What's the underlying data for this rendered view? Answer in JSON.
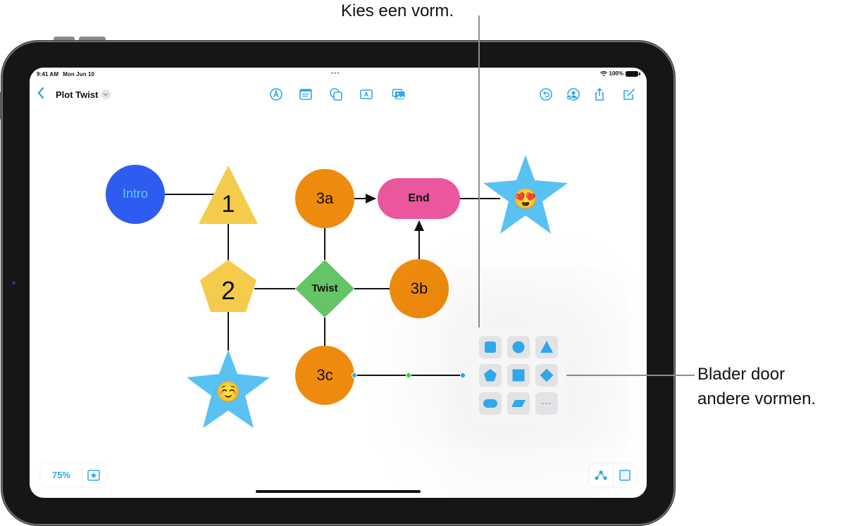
{
  "callouts": {
    "top": "Kies een vorm.",
    "right_line1": "Blader door",
    "right_line2": "andere vormen."
  },
  "status_bar": {
    "time": "9:41 AM",
    "date": "Mon Jun 10",
    "multitask": "•••",
    "battery": "100%",
    "wifi_icon": "wifi-icon",
    "battery_icon": "battery-icon"
  },
  "toolbar": {
    "back_icon": "chevron-left-icon",
    "title": "Plot Twist",
    "title_menu_icon": "chevron-down-icon",
    "center_tools": [
      "pen-icon",
      "text-box-icon",
      "shapes-icon",
      "text-icon",
      "media-icon"
    ],
    "right_tools": [
      "undo-icon",
      "collaborate-icon",
      "share-icon",
      "new-board-icon"
    ]
  },
  "board": {
    "nodes": [
      {
        "id": "intro",
        "label": "Intro",
        "shape": "circle",
        "color": "#2f5cf0",
        "text_color": "#5ac8fa"
      },
      {
        "id": "n1",
        "label": "1",
        "shape": "triangle",
        "color": "#f5cb4b",
        "text_color": "#111111"
      },
      {
        "id": "n2",
        "label": "2",
        "shape": "pentagon",
        "color": "#f5cb4b",
        "text_color": "#111111"
      },
      {
        "id": "star1",
        "label": "☺️",
        "shape": "star",
        "color": "#5ac1f3",
        "text_color": "#111111"
      },
      {
        "id": "n3a",
        "label": "3a",
        "shape": "circle",
        "color": "#ee8a0d",
        "text_color": "#111111"
      },
      {
        "id": "twist",
        "label": "Twist",
        "shape": "diamond",
        "color": "#64c466",
        "text_color": "#111111"
      },
      {
        "id": "n3c",
        "label": "3c",
        "shape": "circle",
        "color": "#ee8a0d",
        "text_color": "#111111"
      },
      {
        "id": "end",
        "label": "End",
        "shape": "rounded-rect",
        "color": "#ea579d",
        "text_color": "#111111"
      },
      {
        "id": "n3b",
        "label": "3b",
        "shape": "circle",
        "color": "#ee8a0d",
        "text_color": "#111111"
      },
      {
        "id": "star2",
        "label": "😍",
        "shape": "star",
        "color": "#5ac1f3",
        "text_color": "#111111"
      }
    ],
    "connections": [
      {
        "from": "intro",
        "to": "n1",
        "arrow": false
      },
      {
        "from": "n1",
        "to": "n2",
        "arrow": false
      },
      {
        "from": "n2",
        "to": "star1",
        "arrow": false
      },
      {
        "from": "n2",
        "to": "twist",
        "arrow": false
      },
      {
        "from": "n3a",
        "to": "twist",
        "arrow": false
      },
      {
        "from": "twist",
        "to": "n3c",
        "arrow": false
      },
      {
        "from": "twist",
        "to": "n3b",
        "arrow": false
      },
      {
        "from": "n3a",
        "to": "end",
        "arrow": true
      },
      {
        "from": "n3b",
        "to": "end",
        "arrow": true
      },
      {
        "from": "end",
        "to": "star2",
        "arrow": false
      },
      {
        "from": "n3c",
        "to": "picker",
        "arrow": false,
        "selected": true
      }
    ]
  },
  "shape_picker": {
    "shapes": [
      "rounded-square",
      "circle",
      "triangle",
      "pentagon",
      "square",
      "diamond",
      "capsule",
      "parallelogram",
      "more"
    ],
    "more_label": "···",
    "accent": "#2ea8e8"
  },
  "bottom_bar": {
    "zoom_level": "75%",
    "favorites_icon": "star-box-icon",
    "connection_icon": "connection-icon",
    "grid_icon": "grid-icon"
  }
}
